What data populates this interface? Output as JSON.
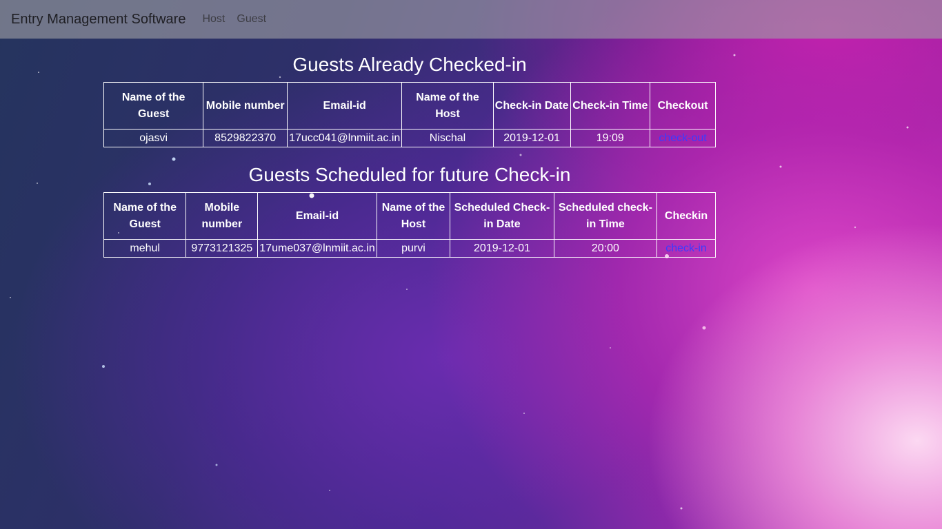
{
  "navbar": {
    "brand": "Entry Management Software",
    "links": [
      "Host",
      "Guest"
    ]
  },
  "checked_in": {
    "title": "Guests Already Checked-in",
    "headers": [
      "Name of the Guest",
      "Mobile number",
      "Email-id",
      "Name of the Host",
      "Check-in Date",
      "Check-in Time",
      "Checkout"
    ],
    "rows": [
      [
        "ojasvi",
        "8529822370",
        "17ucc041@lnmiit.ac.in",
        "Nischal",
        "2019-12-01",
        "19:09",
        "check-out"
      ]
    ]
  },
  "scheduled": {
    "title": "Guests Scheduled for future Check-in",
    "headers": [
      "Name of the Guest",
      "Mobile number",
      "Email-id",
      "Name of the Host",
      "Scheduled Check-in Date",
      "Scheduled check-in Time",
      "Checkin"
    ],
    "rows": [
      [
        "mehul",
        "9773121325",
        "17ume037@lnmiit.ac.in",
        "purvi",
        "2019-12-01",
        "20:00",
        "check-in"
      ]
    ]
  },
  "colors": {
    "link": "#3b3bff",
    "navbar": "#a0a0a5"
  }
}
